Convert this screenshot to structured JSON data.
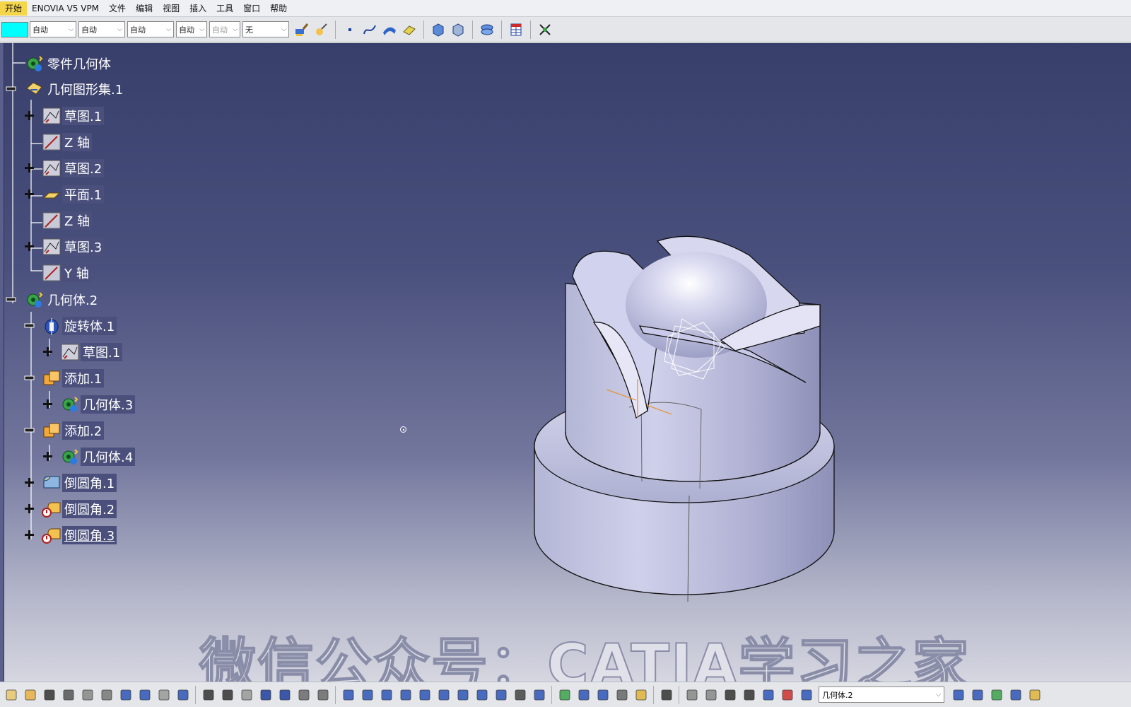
{
  "menu": {
    "items": [
      "开始",
      "ENOVIA V5 VPM",
      "文件",
      "编辑",
      "视图",
      "插入",
      "工具",
      "窗口",
      "帮助"
    ]
  },
  "toolbar_top": {
    "color_swatch": "#00ffff",
    "combos": [
      {
        "value": "自动",
        "disabled": false
      },
      {
        "value": "自动",
        "disabled": false
      },
      {
        "value": "自动",
        "disabled": false
      },
      {
        "value": "自动",
        "disabled": false
      },
      {
        "value": "自动",
        "disabled": true
      },
      {
        "value": "无",
        "disabled": false
      }
    ],
    "icons": [
      "paint-brush-icon",
      "painter-icon",
      "point-icon",
      "spline-icon",
      "surface-icon",
      "eraser-icon",
      "view-normal-icon",
      "view-material-icon",
      "render-style-icon",
      "table-icon",
      "measure-icon"
    ]
  },
  "tree": {
    "nodes": [
      {
        "label": "零件几何体",
        "icon": "partbody-icon",
        "level": 0,
        "expander": "none"
      },
      {
        "label": "几何图形集.1",
        "icon": "geoset-icon",
        "level": 0,
        "expander": "minus"
      },
      {
        "label": "草图.1",
        "icon": "sketch-icon",
        "level": 1,
        "expander": "plus"
      },
      {
        "label": "Z 轴",
        "icon": "axis-icon",
        "level": 1,
        "expander": "none"
      },
      {
        "label": "草图.2",
        "icon": "sketch-icon",
        "level": 1,
        "expander": "plus"
      },
      {
        "label": "平面.1",
        "icon": "plane-icon",
        "level": 1,
        "expander": "plus"
      },
      {
        "label": "Z 轴",
        "icon": "axis-icon",
        "level": 1,
        "expander": "none"
      },
      {
        "label": "草图.3",
        "icon": "sketch-icon",
        "level": 1,
        "expander": "plus"
      },
      {
        "label": "Y 轴",
        "icon": "axis-icon",
        "level": 1,
        "expander": "none"
      },
      {
        "label": "几何体.2",
        "icon": "body-icon",
        "level": 0,
        "expander": "minus"
      },
      {
        "label": "旋转体.1",
        "icon": "shaft-icon",
        "level": 1,
        "expander": "minus"
      },
      {
        "label": "草图.1",
        "icon": "sketch-icon",
        "level": 2,
        "expander": "plus"
      },
      {
        "label": "添加.1",
        "icon": "add-icon",
        "level": 1,
        "expander": "minus"
      },
      {
        "label": "几何体.3",
        "icon": "body-icon",
        "level": 2,
        "expander": "plus"
      },
      {
        "label": "添加.2",
        "icon": "add-icon",
        "level": 1,
        "expander": "minus"
      },
      {
        "label": "几何体.4",
        "icon": "body-icon",
        "level": 2,
        "expander": "plus"
      },
      {
        "label": "倒圆角.1",
        "icon": "fillet-icon",
        "level": 1,
        "expander": "plus"
      },
      {
        "label": "倒圆角.2",
        "icon": "fillet-error-icon",
        "level": 1,
        "expander": "plus"
      },
      {
        "label": "倒圆角.3",
        "icon": "fillet-error-icon",
        "level": 1,
        "expander": "plus",
        "selected": true
      }
    ]
  },
  "watermark": "微信公众号：CATIA学习之家",
  "toolbar_bottom": {
    "current_body": "几何体.2",
    "icons": [
      "new-icon",
      "open-icon",
      "save-icon",
      "print-icon",
      "cut-icon",
      "copy-icon",
      "paste-icon",
      "undo-icon",
      "redo-icon",
      "whats-this-icon",
      "formula-icon",
      "comment-icon",
      "knowledge-icon",
      "table-icon",
      "tree-icon",
      "catalog-icon",
      "structure-icon",
      "select-icon",
      "fit-all-icon",
      "pan-icon",
      "rotate-icon",
      "zoom-in-icon",
      "zoom-out-icon",
      "normal-view-icon",
      "multi-view-icon",
      "iso-view-icon",
      "hide-show-icon",
      "swap-space-icon",
      "render-icon",
      "update-icon",
      "measure-between-icon",
      "measure-item-icon",
      "mass-icon",
      "capture-icon",
      "flex-icon",
      "grab-icon",
      "axis-system-icon",
      "dimension-icon",
      "layer-icon",
      "constraint-icon",
      "list-icon",
      "body-icon",
      "sketcher-icon",
      "param-icon",
      "chart-icon",
      "analysis-icon"
    ]
  }
}
